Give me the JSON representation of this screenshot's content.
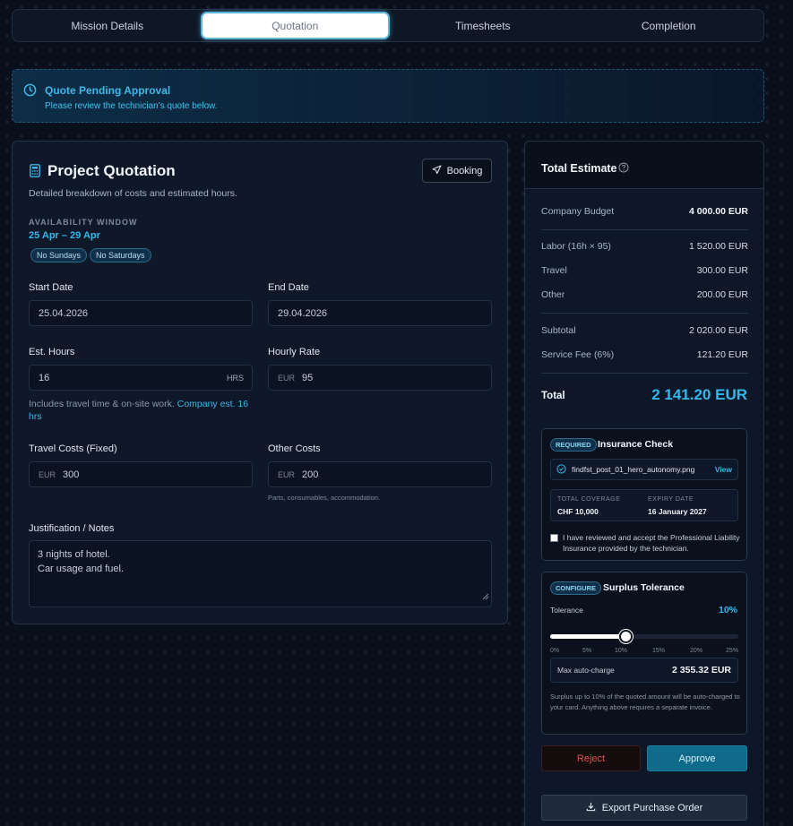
{
  "tabs": [
    {
      "label": "Mission Details"
    },
    {
      "label": "Quotation"
    },
    {
      "label": "Timesheets"
    },
    {
      "label": "Completion"
    }
  ],
  "banner": {
    "title": "Quote Pending Approval",
    "subtitle": "Please review the technician's quote below."
  },
  "quotation": {
    "title": "Project Quotation",
    "subtitle": "Detailed breakdown of costs and estimated hours.",
    "booking_label": "Booking",
    "availability_label": "AVAILABILITY WINDOW",
    "availability_range": "25 Apr – 29 Apr",
    "chips": [
      "No Sundays",
      "No Saturdays"
    ],
    "start_date": {
      "label": "Start Date",
      "value": "25.04.2026"
    },
    "end_date": {
      "label": "End Date",
      "value": "29.04.2026"
    },
    "est_hours": {
      "label": "Est. Hours",
      "value": "16",
      "suffix": "HRS"
    },
    "hourly_rate": {
      "label": "Hourly Rate",
      "prefix": "EUR",
      "value": "95"
    },
    "hours_hint": "Includes travel time & on-site work.",
    "hours_hint_link": "Company est. 16 hrs",
    "travel": {
      "label": "Travel Costs (Fixed)",
      "prefix": "EUR",
      "value": "300"
    },
    "other": {
      "label": "Other Costs",
      "prefix": "EUR",
      "value": "200",
      "hint": "Parts, consumables, accommodation."
    },
    "notes": {
      "label": "Justification / Notes",
      "line1": "3 nights of hotel.",
      "line2": "Car usage and fuel."
    }
  },
  "estimate": {
    "title": "Total Estimate",
    "company_budget": {
      "label": "Company Budget",
      "value": "4 000.00 EUR"
    },
    "labor": {
      "label": "Labor (16h × 95)",
      "value": "1 520.00 EUR"
    },
    "travel": {
      "label": "Travel",
      "value": "300.00 EUR"
    },
    "other": {
      "label": "Other",
      "value": "200.00 EUR"
    },
    "subtotal": {
      "label": "Subtotal",
      "value": "2 020.00 EUR"
    },
    "service_fee": {
      "label": "Service Fee (6%)",
      "value": "121.20 EUR"
    },
    "total": {
      "label": "Total",
      "value": "2 141.20 EUR"
    }
  },
  "insurance": {
    "badge": "REQUIRED",
    "title": "Insurance Check",
    "file_name": "findfst_post_01_hero_autonomy.png",
    "view_label": "View",
    "coverage_label": "TOTAL COVERAGE",
    "coverage_value": "CHF 10,000",
    "expiry_label": "EXPIRY DATE",
    "expiry_value": "16 January 2027",
    "accept_text": "I have reviewed and accept the Professional Liability Insurance provided by the technician.",
    "accepted": false
  },
  "surplus": {
    "badge": "CONFIGURE",
    "title": "Surplus Tolerance",
    "tolerance_label": "Tolerance",
    "tolerance_value": "10%",
    "tolerance_fraction": 0.4,
    "ticks": [
      "0%",
      "5%",
      "10%",
      "15%",
      "20%",
      "25%"
    ],
    "max_label": "Max auto-charge",
    "max_value": "2 355.32 EUR",
    "note": "Surplus up to 10% of the quoted amount will be auto-charged to your card. Anything above requires a separate invoice."
  },
  "actions": {
    "reject_label": "Reject",
    "approve_label": "Approve",
    "export_label": "Export Purchase Order"
  },
  "colors": {
    "accent": "#35b8ec",
    "reject": "#e0524f",
    "approve_bg": "#106a8a"
  }
}
